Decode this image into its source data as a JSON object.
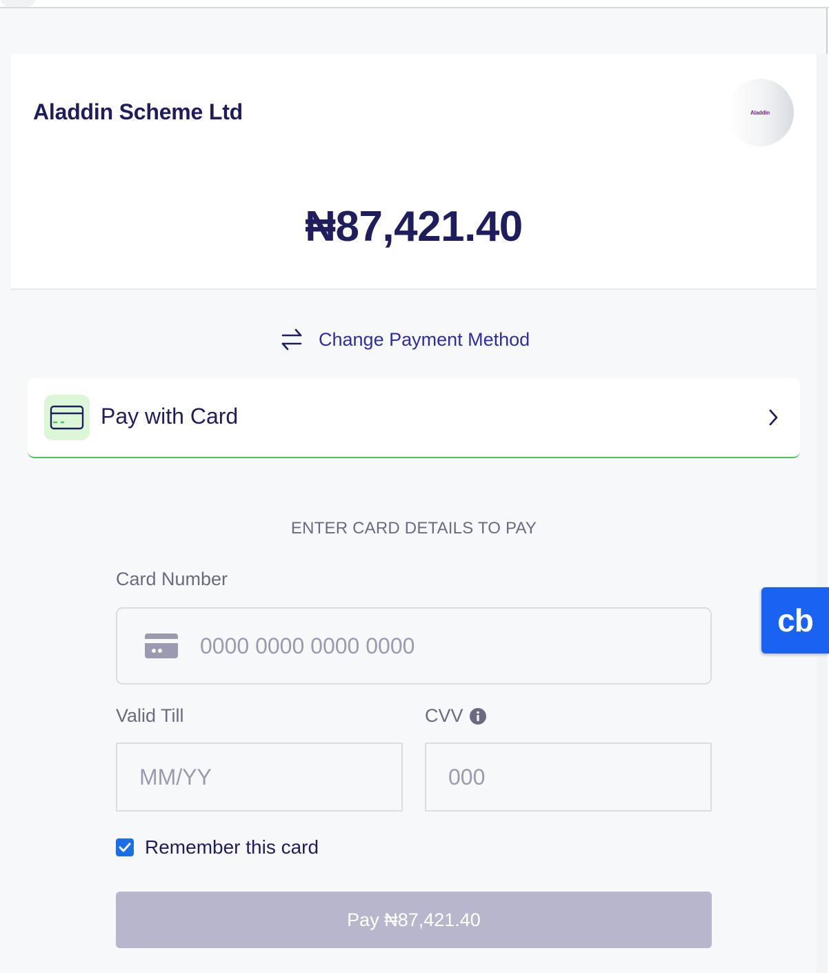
{
  "merchant": {
    "name": "Aladdin Scheme Ltd",
    "logo_text": "Aladdin"
  },
  "amount": {
    "display": "₦87,421.40"
  },
  "change_method": {
    "label": "Change Payment Method",
    "icon": "swap-arrows-icon"
  },
  "payment_method": {
    "label": "Pay with Card",
    "icon": "credit-card-icon",
    "chevron_icon": "chevron-right-icon",
    "accent_color": "#4cc35a"
  },
  "form": {
    "title": "ENTER CARD DETAILS TO PAY",
    "card_number": {
      "label": "Card Number",
      "placeholder": "0000 0000 0000 0000",
      "value": ""
    },
    "valid_till": {
      "label": "Valid Till",
      "placeholder": "MM/YY",
      "value": ""
    },
    "cvv": {
      "label": "CVV",
      "placeholder": "000",
      "value": "",
      "info_icon": "info-icon"
    },
    "remember": {
      "label": "Remember this card",
      "checked": true
    },
    "submit": {
      "label": "Pay ₦87,421.40",
      "disabled": true
    }
  },
  "badge": {
    "text": "cb"
  },
  "colors": {
    "primary_text": "#1f1d5c",
    "link": "#2f2da6",
    "button_disabled": "#b7b6cc",
    "checkbox": "#1b6fe6",
    "badge": "#1962f2"
  }
}
